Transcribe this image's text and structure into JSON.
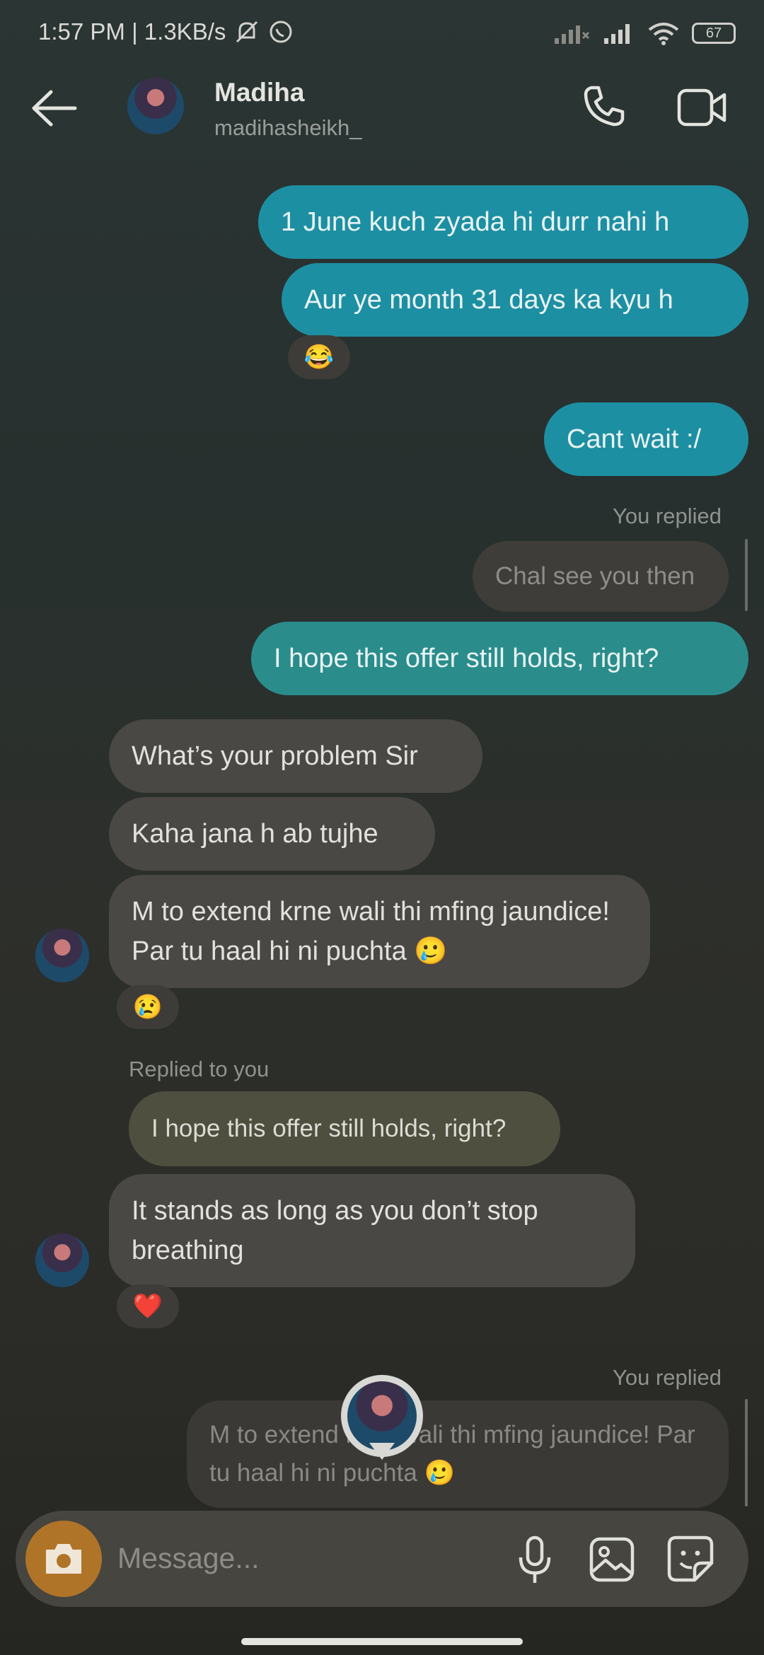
{
  "status_bar": {
    "time_speed": "1:57 PM | 1.3KB/s",
    "battery": "67"
  },
  "header": {
    "name": "Madiha",
    "username": "madihasheikh_"
  },
  "messages": {
    "m1": "1 June kuch zyada hi durr nahi h",
    "m2": "Aur ye month 31 days ka kyu h",
    "m2_reaction": "😂",
    "m3": "Cant wait :/",
    "you_replied_1": "You replied",
    "quoted_1": "Chal see you then",
    "m4": "I hope this offer still holds, right?",
    "r1": "What’s your problem Sir",
    "r2": "Kaha jana h ab tujhe",
    "r3": "M to extend krne wali thi mfing jaundice! Par tu haal hi ni puchta 🥲",
    "r3_reaction": "😢",
    "replied_to_you": "Replied to you",
    "quoted_2": "I hope this offer still holds, right?",
    "r4": "It stands as long as you don’t stop breathing",
    "r4_reaction": "❤️",
    "you_replied_2": "You replied",
    "quoted_3": "M to extend krne wali thi mfing jaundice! Par tu haal hi ni puchta 🥲"
  },
  "composer": {
    "placeholder": "Message..."
  },
  "icons": [
    "back-arrow-icon",
    "phone-icon",
    "video-icon",
    "camera-icon",
    "mic-icon",
    "gallery-icon",
    "sticker-icon"
  ]
}
